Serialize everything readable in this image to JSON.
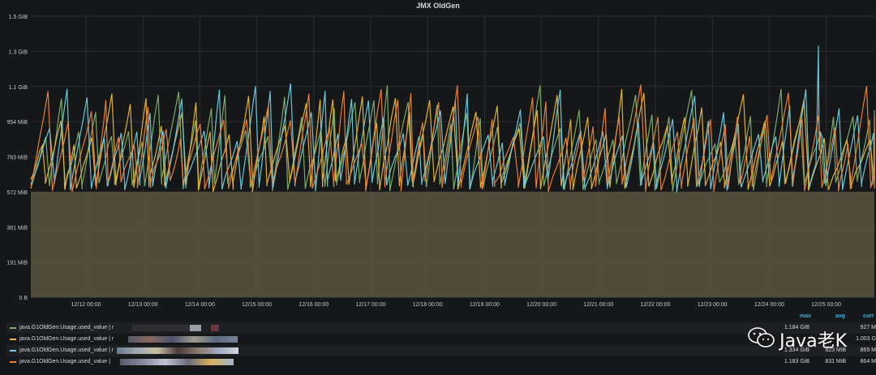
{
  "panel": {
    "title": "JMX OldGen"
  },
  "chart_data": {
    "type": "line",
    "title": "JMX OldGen",
    "y_ticks": [
      "0 B",
      "191 MiB",
      "381 MiB",
      "572 MiB",
      "763 MiB",
      "954 MiB",
      "1.1 GiB",
      "1.3 GiB",
      "1.5 GiB"
    ],
    "x_ticks": [
      "12/12 00:00",
      "12/13 00:00",
      "12/14 00:00",
      "12/15 00:00",
      "12/16 00:00",
      "12/17 00:00",
      "12/18 00:00",
      "12/19 00:00",
      "12/20 00:00",
      "12/21 00:00",
      "12/22 00:00",
      "12/23 00:00",
      "12/24 00:00",
      "12/25 00:00"
    ],
    "ylim_mib": [
      0,
      1526
    ],
    "baseline_mib": 572,
    "series": [
      {
        "name": "java.G1OldGen.Usage.used_value | r...",
        "color": "#7eb26d",
        "max_mib": 1212,
        "min_mib": 580
      },
      {
        "name": "java.G1OldGen.Usage.used_value | r...",
        "color": "#eab839",
        "max_mib": 1150,
        "min_mib": 580
      },
      {
        "name": "java.G1OldGen.Usage.used_value | r...",
        "color": "#6ed0e0",
        "max_mib": 1366,
        "min_mib": 580
      },
      {
        "name": "java.G1OldGen.Usage.used_value | r...",
        "color": "#ef843c",
        "max_mib": 1211,
        "min_mib": 580
      }
    ]
  },
  "legend": {
    "headers": {
      "max": "max",
      "avg": "avg",
      "current": "curr"
    },
    "rows": [
      {
        "name": "java.G1OldGen.Usage.used_value | r",
        "color": "#7eb26d",
        "max": "1.184 GiB",
        "avg": "",
        "current": "927 M"
      },
      {
        "name": "java.G1OldGen.Usage.used_value | r",
        "color": "#eab839",
        "max": "",
        "avg": "",
        "current": "1.003 G"
      },
      {
        "name": "java.G1OldGen.Usage.used_value | r",
        "color": "#6ed0e0",
        "max": "1.334 GiB",
        "avg": "823 MiB",
        "current": "869 M"
      },
      {
        "name": "java.G1OldGen.Usage.used_value |",
        "color": "#ef843c",
        "max": "1.183 GiB",
        "avg": "831 MiB",
        "current": "864 M"
      }
    ]
  },
  "watermark": {
    "text": "Java老K",
    "icon": "wechat-icon"
  }
}
